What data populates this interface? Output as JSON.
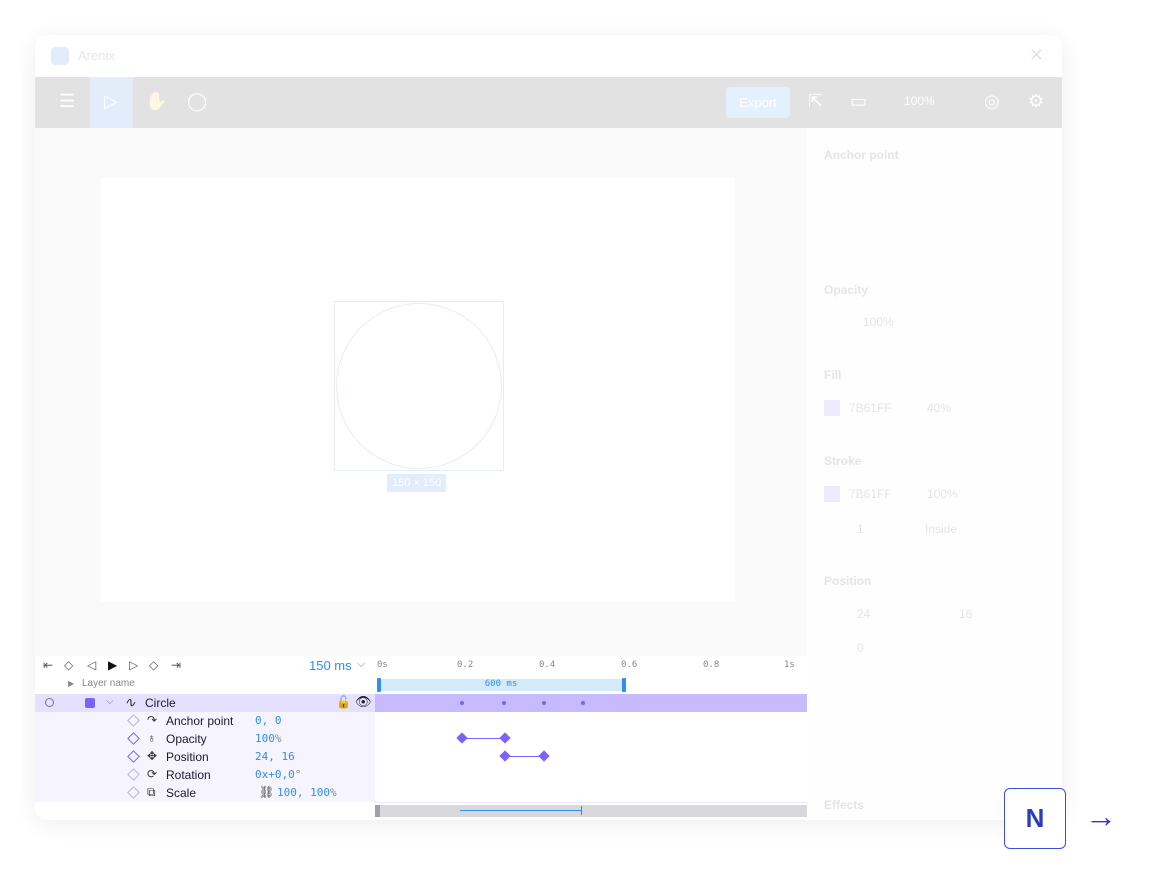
{
  "app": {
    "title": "Arenix"
  },
  "toolbar": {
    "export_label": "Export",
    "zoom": "100%"
  },
  "canvas": {
    "size_badge": "150 × 150"
  },
  "right_panel": {
    "anchor_label": "Anchor point",
    "opacity_label": "Opacity",
    "opacity_value": "100%",
    "fill_label": "Fill",
    "fill_hex": "7B61FF",
    "fill_opacity": "40%",
    "stroke_label": "Stroke",
    "stroke_hex": "7B61FF",
    "stroke_opacity": "100%",
    "stroke_width": "1",
    "stroke_pos": "Inside",
    "position_label": "Position",
    "pos_x": "24",
    "pos_y": "16",
    "pos_r": "0",
    "effects_label": "Effects"
  },
  "timeline": {
    "duration": "150 ms",
    "ticks": [
      "0s",
      "0.2",
      "0.4",
      "0.6",
      "0.8",
      "1s"
    ],
    "layer_header": "Layer name",
    "range_label": "600 ms",
    "layer": {
      "name": "Circle"
    },
    "properties": [
      {
        "name": "Anchor point",
        "value": "0, 0",
        "unit": ""
      },
      {
        "name": "Opacity",
        "value": "100",
        "unit": "%"
      },
      {
        "name": "Position",
        "value": "24, 16",
        "unit": ""
      },
      {
        "name": "Rotation",
        "value": "0x+0,0",
        "unit": "°"
      },
      {
        "name": "Scale",
        "value": "100, 100",
        "unit": "%"
      }
    ]
  },
  "nav": {
    "n_label": "N",
    "next_icon": "arrow-right-icon"
  },
  "colors": {
    "accent": "#7B61FF",
    "blue": "#2d8ff0"
  }
}
